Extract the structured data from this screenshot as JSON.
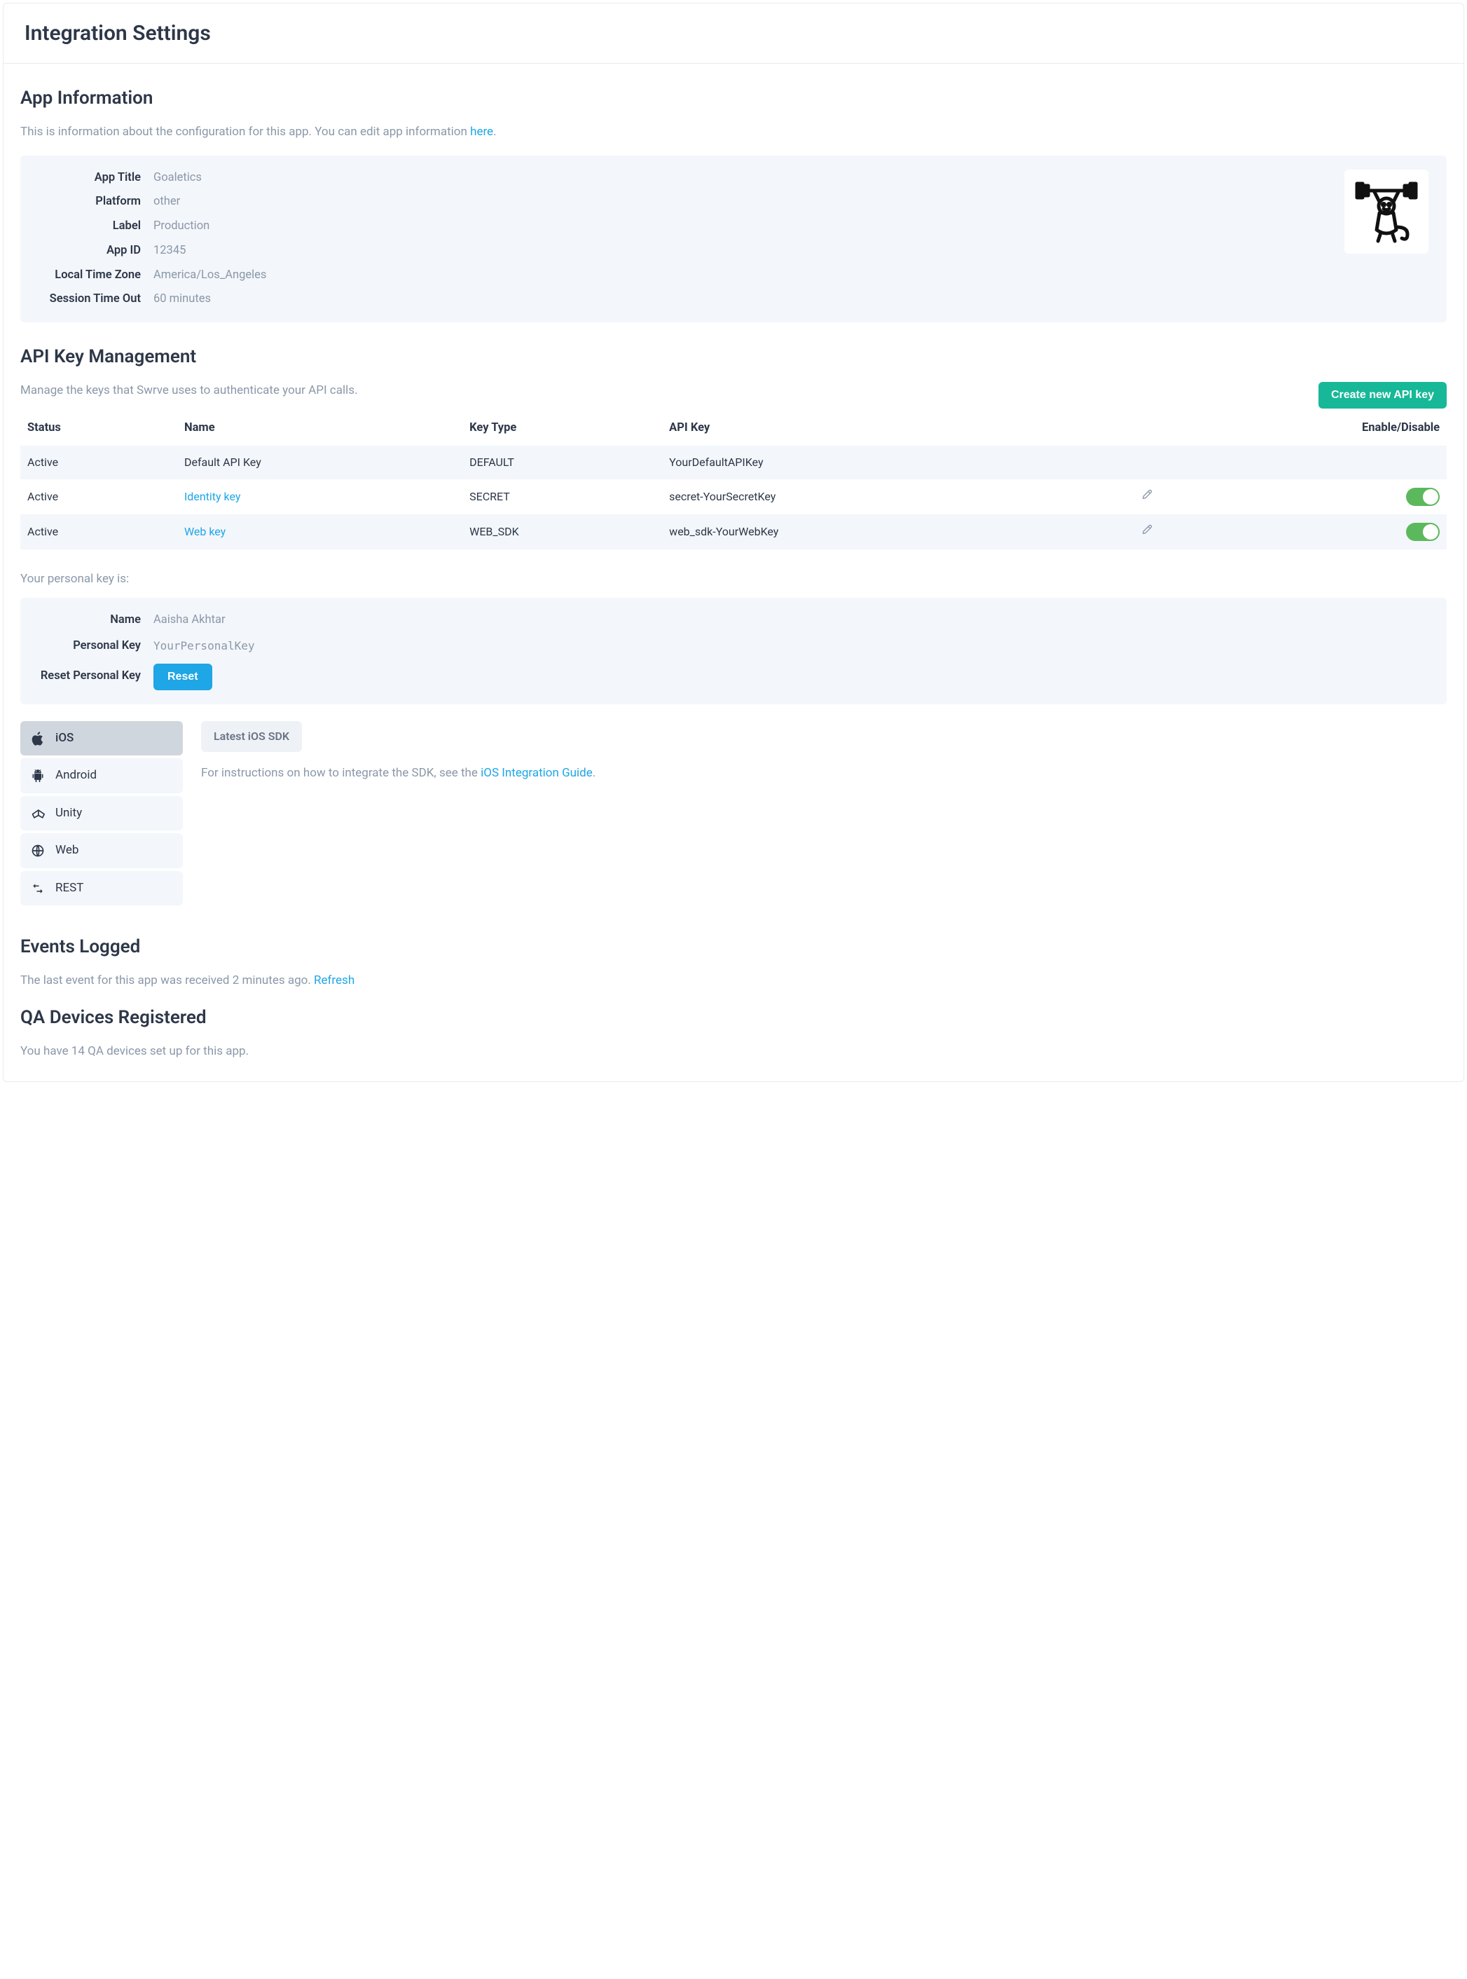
{
  "header": {
    "title": "Integration Settings"
  },
  "app_info": {
    "title": "App Information",
    "desc_pre": "This is information about the configuration for this app. You can edit app information ",
    "desc_link": "here",
    "desc_post": ".",
    "rows": {
      "app_title_k": "App Title",
      "app_title_v": "Goaletics",
      "platform_k": "Platform",
      "platform_v": "other",
      "label_k": "Label",
      "label_v": "Production",
      "app_id_k": "App ID",
      "app_id_v": "12345",
      "tz_k": "Local Time Zone",
      "tz_v": "America/Los_Angeles",
      "timeout_k": "Session Time Out",
      "timeout_v": "60 minutes"
    }
  },
  "api": {
    "title": "API Key Management",
    "desc": "Manage the keys that Swrve uses to authenticate your API calls.",
    "create_btn": "Create new API key",
    "cols": {
      "status": "Status",
      "name": "Name",
      "type": "Key Type",
      "key": "API Key",
      "toggle": "Enable/Disable"
    },
    "rows": [
      {
        "status": "Active",
        "name": "Default API Key",
        "name_link": false,
        "type": "DEFAULT",
        "key": "YourDefaultAPIKey",
        "editable": false,
        "toggle": false
      },
      {
        "status": "Active",
        "name": "Identity key",
        "name_link": true,
        "type": "SECRET",
        "key": "secret-YourSecretKey",
        "editable": true,
        "toggle": true
      },
      {
        "status": "Active",
        "name": "Web key",
        "name_link": true,
        "type": "WEB_SDK",
        "key": "web_sdk-YourWebKey",
        "editable": true,
        "toggle": true
      }
    ],
    "personal_label": "Your personal key is:",
    "personal": {
      "name_k": "Name",
      "name_v": "Aaisha Akhtar",
      "key_k": "Personal Key",
      "key_v": "YourPersonalKey",
      "reset_k": "Reset Personal Key",
      "reset_btn": "Reset"
    }
  },
  "sdk": {
    "tabs": [
      {
        "id": "ios",
        "label": "iOS"
      },
      {
        "id": "android",
        "label": "Android"
      },
      {
        "id": "unity",
        "label": "Unity"
      },
      {
        "id": "web",
        "label": "Web"
      },
      {
        "id": "rest",
        "label": "REST"
      }
    ],
    "pill": "Latest iOS SDK",
    "desc_pre": "For instructions on how to integrate the SDK, see the ",
    "desc_link": "iOS Integration Guide",
    "desc_post": "."
  },
  "events": {
    "title": "Events Logged",
    "desc_pre": "The last event for this app was received 2 minutes ago. ",
    "refresh": "Refresh"
  },
  "qa": {
    "title": "QA Devices Registered",
    "desc": "You have 14 QA devices set up for this app."
  }
}
